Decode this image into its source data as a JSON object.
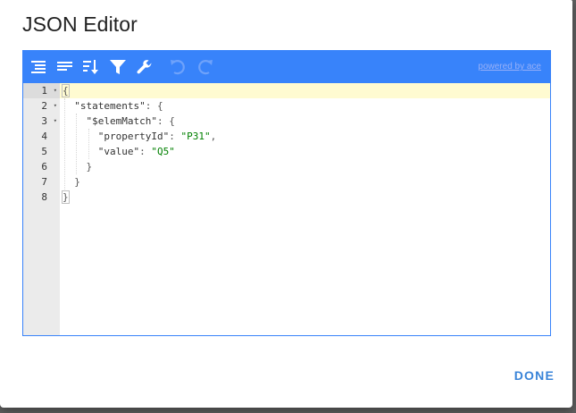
{
  "dialog": {
    "title": "JSON Editor",
    "done_label": "DONE"
  },
  "toolbar": {
    "icons": [
      "format-icon",
      "compact-icon",
      "sort-icon",
      "filter-icon",
      "repair-icon",
      "undo-icon",
      "redo-icon"
    ],
    "powered_by": "powered by ace",
    "background_color": "#3883fa"
  },
  "editor": {
    "line_numbers": [
      "1",
      "2",
      "3",
      "4",
      "5",
      "6",
      "7",
      "8"
    ],
    "active_line": 1,
    "lines": [
      {
        "tokens": [
          {
            "t": "{",
            "c": "punc"
          }
        ]
      },
      {
        "tokens": [
          {
            "t": "  ",
            "c": "punc"
          },
          {
            "t": "\"statements\"",
            "c": "key"
          },
          {
            "t": ": {",
            "c": "punc"
          }
        ]
      },
      {
        "tokens": [
          {
            "t": "    ",
            "c": "punc"
          },
          {
            "t": "\"$elemMatch\"",
            "c": "key"
          },
          {
            "t": ": {",
            "c": "punc"
          }
        ]
      },
      {
        "tokens": [
          {
            "t": "      ",
            "c": "punc"
          },
          {
            "t": "\"propertyId\"",
            "c": "key"
          },
          {
            "t": ": ",
            "c": "punc"
          },
          {
            "t": "\"P31\"",
            "c": "str"
          },
          {
            "t": ",",
            "c": "punc"
          }
        ]
      },
      {
        "tokens": [
          {
            "t": "      ",
            "c": "punc"
          },
          {
            "t": "\"value\"",
            "c": "key"
          },
          {
            "t": ": ",
            "c": "punc"
          },
          {
            "t": "\"Q5\"",
            "c": "str"
          }
        ]
      },
      {
        "tokens": [
          {
            "t": "    }",
            "c": "punc"
          }
        ]
      },
      {
        "tokens": [
          {
            "t": "  }",
            "c": "punc"
          }
        ]
      },
      {
        "tokens": [
          {
            "t": "}",
            "c": "punc"
          }
        ]
      }
    ],
    "colors": {
      "string": "#008000",
      "active_line": "#fffbd1",
      "gutter": "#ebebeb"
    }
  }
}
